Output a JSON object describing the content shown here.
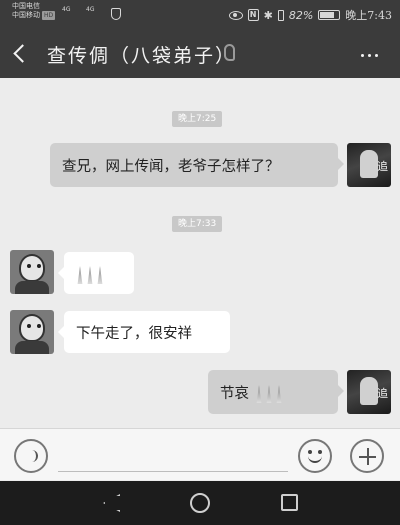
{
  "status_bar": {
    "carrier_1": "中国电信",
    "carrier_2": "中国移动",
    "carrier_2_badge": "HD",
    "signal_1": "4G",
    "signal_2": "4G",
    "battery_percent": "82%",
    "battery_level": 0.82,
    "time": "晚上7:43",
    "icons": [
      "eye-icon",
      "nfc-icon",
      "bluetooth-icon",
      "vibrate-icon",
      "battery-icon"
    ]
  },
  "header": {
    "back_icon": "back-arrow-icon",
    "title": "查传倜（八袋弟子）",
    "ear_icon": "earpiece-icon",
    "more_icon": "more-icon"
  },
  "messages": [
    {
      "type": "time",
      "text": "晚上7:25"
    },
    {
      "type": "sent",
      "text": "查兄，网上传闻，老爷子怎样了？"
    },
    {
      "type": "time",
      "text": "晚上7:33"
    },
    {
      "type": "received",
      "emoji": "candles",
      "count": 3
    },
    {
      "type": "received",
      "text": "下午走了，很安祥"
    },
    {
      "type": "sent",
      "text": "节哀",
      "emoji": "candles",
      "count": 3
    }
  ],
  "input_bar": {
    "voice_icon": "voice-icon",
    "emoji_icon": "smiley-icon",
    "add_icon": "plus-icon",
    "input_value": ""
  },
  "nav_bar": {
    "icons": [
      "nav-back-icon",
      "nav-home-icon",
      "nav-recents-icon"
    ]
  },
  "colors": {
    "header_bg": "#3b3b3b",
    "chat_bg": "#ececec",
    "sent_bubble": "#cfcfcf",
    "received_bubble": "#ffffff",
    "nav_bg": "#1c1c1c"
  }
}
